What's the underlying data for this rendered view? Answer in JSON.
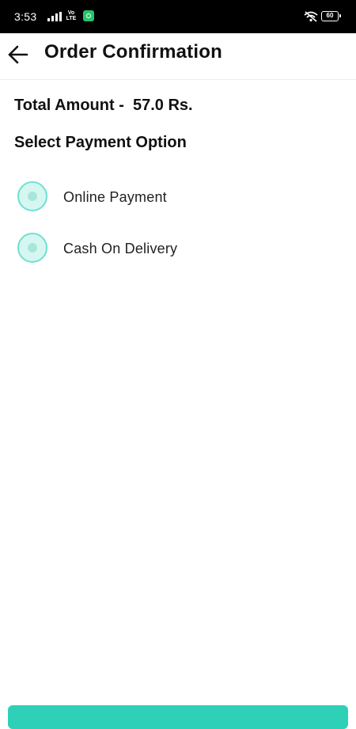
{
  "status_bar": {
    "time": "3:53",
    "network_label": "Vo LTE",
    "battery": "60",
    "signal_icon": "signal-bars-icon",
    "app_icon": "app-notification-icon",
    "wifi_icon": "wifi-off-icon"
  },
  "app_bar": {
    "back_icon": "arrow-left-icon",
    "title": "Order Confirmation"
  },
  "order": {
    "total_label": "Total Amount -",
    "total_value": "57.0 Rs."
  },
  "payment": {
    "section_title": "Select Payment Option",
    "options": [
      {
        "label": "Online Payment",
        "selected": false
      },
      {
        "label": "Cash On Delivery",
        "selected": false
      }
    ]
  },
  "colors": {
    "accent": "#2ed1b8",
    "radio_fill": "#d6f7f1",
    "radio_border": "#6fe0d2"
  }
}
